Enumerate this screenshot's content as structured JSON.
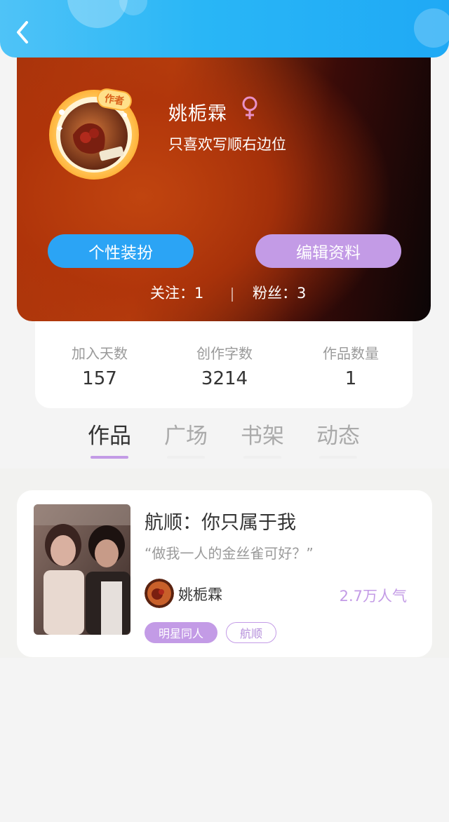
{
  "profile": {
    "name": "姚栀霖",
    "motto": "只喜欢写顺右边位",
    "avatar_badge": "作者",
    "buttons": {
      "dress_up": "个性装扮",
      "edit_profile": "编辑资料"
    },
    "following_label": "关注：1",
    "followers_label": "粉丝：3"
  },
  "stats": [
    {
      "label": "加入天数",
      "value": "157"
    },
    {
      "label": "创作字数",
      "value": "3214"
    },
    {
      "label": "作品数量",
      "value": "1"
    }
  ],
  "tabs": [
    {
      "label": "作品",
      "active": true
    },
    {
      "label": "广场",
      "active": false
    },
    {
      "label": "书架",
      "active": false
    },
    {
      "label": "动态",
      "active": false
    }
  ],
  "work": {
    "title": "航顺：你只属于我",
    "quote": "“做我一人的金丝雀可好？”",
    "author": "姚栀霖",
    "popularity": "2.7万人气",
    "tags": [
      "明星同人",
      "航顺"
    ]
  },
  "colors": {
    "top_bar": "#29b6f6",
    "accent_blue": "#2ba4f5",
    "accent_purple": "#c39be6",
    "gender_female": "#e891c8"
  },
  "icons": {
    "back": "chevron-left-icon",
    "gender": "female-symbol-icon"
  }
}
